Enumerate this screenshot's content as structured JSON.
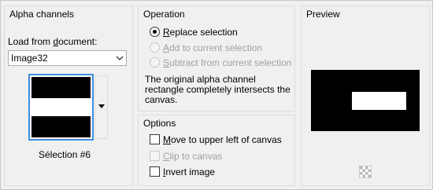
{
  "alpha_channels": {
    "title": "Alpha channels",
    "load_label_prefix": "Load from ",
    "load_label_mnemonic": "d",
    "load_label_suffix": "ocument:",
    "document_value": "Image32",
    "selection_label": "Sélection #6"
  },
  "operation": {
    "title": "Operation",
    "options": [
      {
        "mnemonic": "R",
        "rest": "eplace selection",
        "selected": true,
        "enabled": true
      },
      {
        "mnemonic": "A",
        "rest": "dd to current selection",
        "selected": false,
        "enabled": false
      },
      {
        "mnemonic": "S",
        "rest": "ubtract from current selection",
        "selected": false,
        "enabled": false
      }
    ],
    "info_text": "The original alpha channel rectangle completely intersects the canvas."
  },
  "options": {
    "title": "Options",
    "items": [
      {
        "mnemonic": "M",
        "rest": "ove to upper left of canvas",
        "checked": false,
        "enabled": true
      },
      {
        "mnemonic": "C",
        "rest": "lip to canvas",
        "checked": false,
        "enabled": false
      },
      {
        "mnemonic": "I",
        "rest": "nvert image",
        "checked": false,
        "enabled": true
      }
    ]
  },
  "preview": {
    "title": "Preview",
    "transparency_icon": "checkerboard-icon"
  },
  "colors": {
    "background": "#f0f0f0",
    "selection_border": "#3b8ee0",
    "disabled_text": "#a0a0a0"
  }
}
